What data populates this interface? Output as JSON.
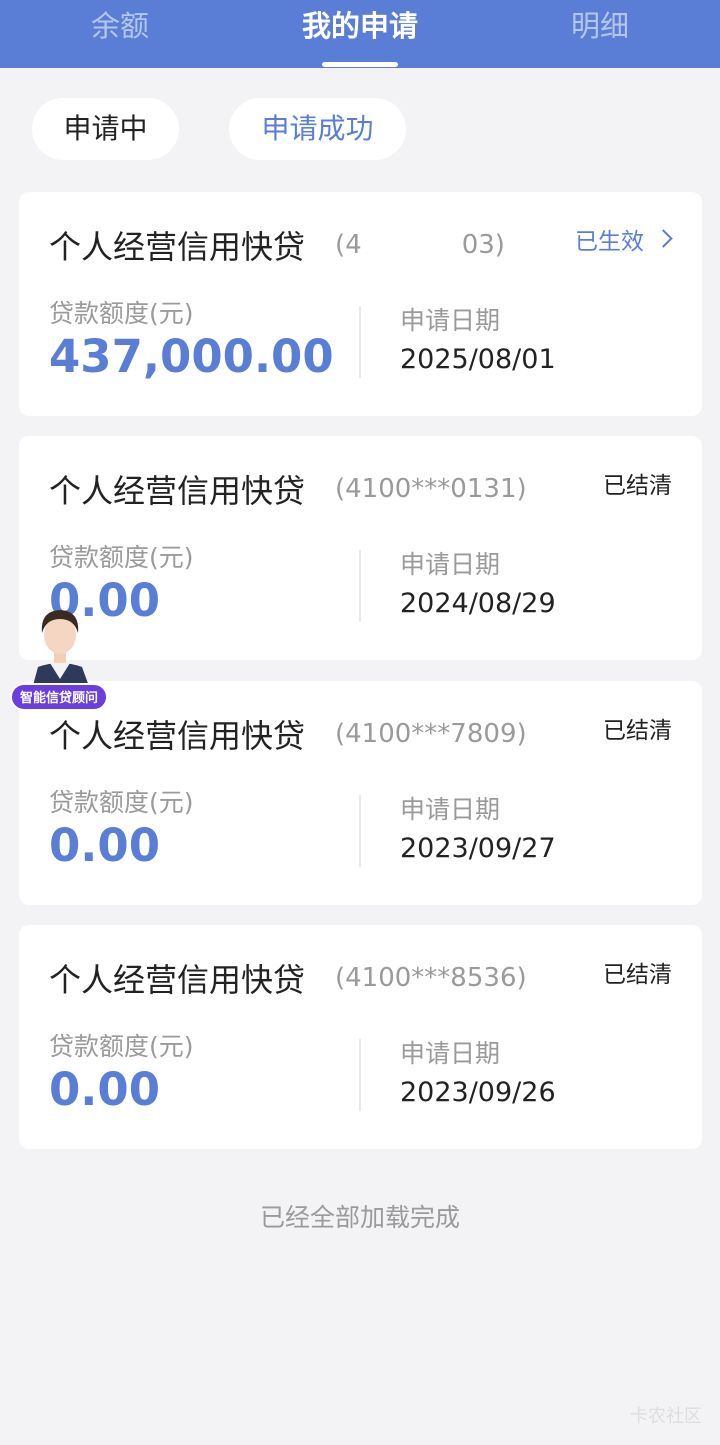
{
  "tabs": [
    {
      "label": "余额"
    },
    {
      "label": "我的申请"
    },
    {
      "label": "明细"
    }
  ],
  "filters": [
    {
      "label": "申请中"
    },
    {
      "label": "申请成功"
    }
  ],
  "cards": [
    {
      "title": "个人经营信用快贷",
      "account": "(4",
      "account_tail": "03)",
      "status": "已生效",
      "amount_label": "贷款额度(元)",
      "amount": "437,000.00",
      "date_label": "申请日期",
      "date": "2025/08/01"
    },
    {
      "title": "个人经营信用快贷",
      "account": "(4100***0131)",
      "status": "已结清",
      "amount_label": "贷款额度(元)",
      "amount": "0.00",
      "date_label": "申请日期",
      "date": "2024/08/29"
    },
    {
      "title": "个人经营信用快贷",
      "account": "(4100***7809)",
      "status": "已结清",
      "amount_label": "贷款额度(元)",
      "amount": "0.00",
      "date_label": "申请日期",
      "date": "2023/09/27"
    },
    {
      "title": "个人经营信用快贷",
      "account": "(4100***8536)",
      "status": "已结清",
      "amount_label": "贷款额度(元)",
      "amount": "0.00",
      "date_label": "申请日期",
      "date": "2023/09/26"
    }
  ],
  "assistant": {
    "badge": "智能信贷顾问"
  },
  "footer": {
    "text": "已经全部加载完成"
  },
  "watermark": {
    "text": "卡农社区"
  },
  "colors": {
    "accent": "#5a7ed6",
    "background": "#f3f3f5",
    "badge": "#6a3ee0"
  }
}
